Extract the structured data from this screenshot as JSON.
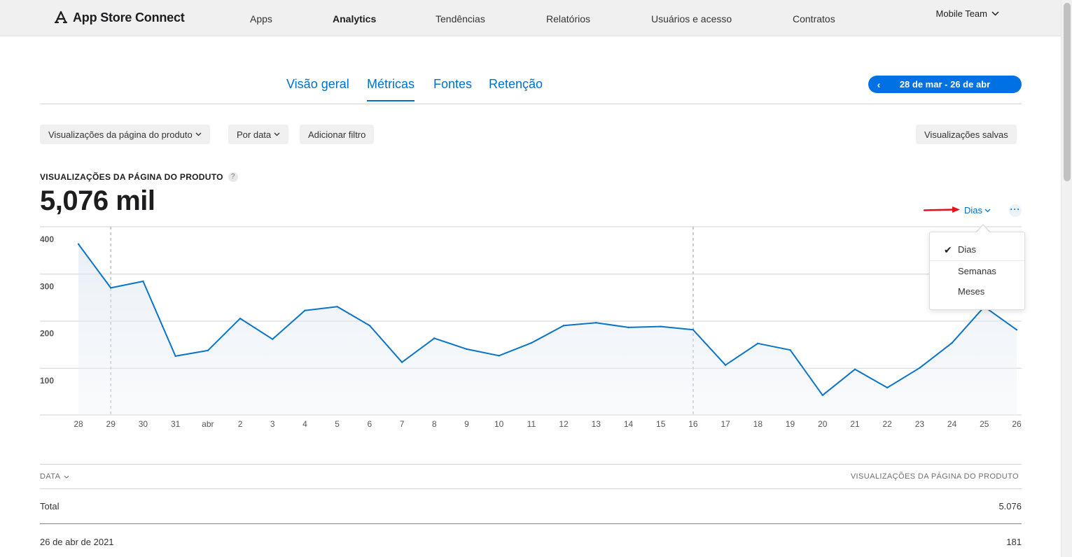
{
  "topnav": {
    "brand": "App Store Connect",
    "items": [
      "Apps",
      "Analytics",
      "Tendências",
      "Relatórios",
      "Usuários e acesso",
      "Contratos"
    ],
    "active": "Analytics",
    "team": "Mobile Team"
  },
  "tabs": {
    "items": [
      "Visão geral",
      "Métricas",
      "Fontes",
      "Retenção"
    ],
    "active": "Métricas",
    "date_range": "28 de mar - 26 de abr"
  },
  "filters": {
    "metric": "Visualizações da página do produto",
    "group": "Por data",
    "add": "Adicionar filtro",
    "saved": "Visualizações salvas"
  },
  "metric": {
    "title": "VISUALIZAÇÕES DA PÁGINA DO PRODUTO",
    "help": "?",
    "value": "5,076 mil"
  },
  "interval": {
    "label": "Dias",
    "options": [
      "Dias",
      "Semanas",
      "Meses"
    ],
    "selected": "Dias",
    "more": "···"
  },
  "colors": {
    "accent": "#0070c9",
    "line": "#0a74c9",
    "annotation_arrow": "#e8101a"
  },
  "chart_data": {
    "type": "line",
    "x": [
      "28",
      "29",
      "30",
      "31",
      "abr",
      "2",
      "3",
      "4",
      "5",
      "6",
      "7",
      "8",
      "9",
      "10",
      "11",
      "12",
      "13",
      "14",
      "15",
      "16",
      "17",
      "18",
      "19",
      "20",
      "21",
      "22",
      "23",
      "24",
      "25",
      "26"
    ],
    "series": [
      {
        "values": [
          363,
          270,
          284,
          125,
          137,
          205,
          161,
          222,
          230,
          190,
          112,
          163,
          140,
          126,
          153,
          190,
          196,
          186,
          188,
          181,
          106,
          152,
          138,
          42,
          97,
          58,
          100,
          153,
          230,
          181
        ]
      }
    ],
    "yticks": [
      100,
      200,
      300,
      400
    ],
    "ylim": [
      0,
      400
    ],
    "grid": true,
    "week_markers": [
      "29",
      "16"
    ]
  },
  "table": {
    "col_date": "DATA",
    "col_value": "VISUALIZAÇÕES DA PÁGINA DO PRODUTO",
    "rows": [
      {
        "date": "Total",
        "value": "5.076"
      },
      {
        "date": "26 de abr de 2021",
        "value": "181"
      }
    ]
  }
}
